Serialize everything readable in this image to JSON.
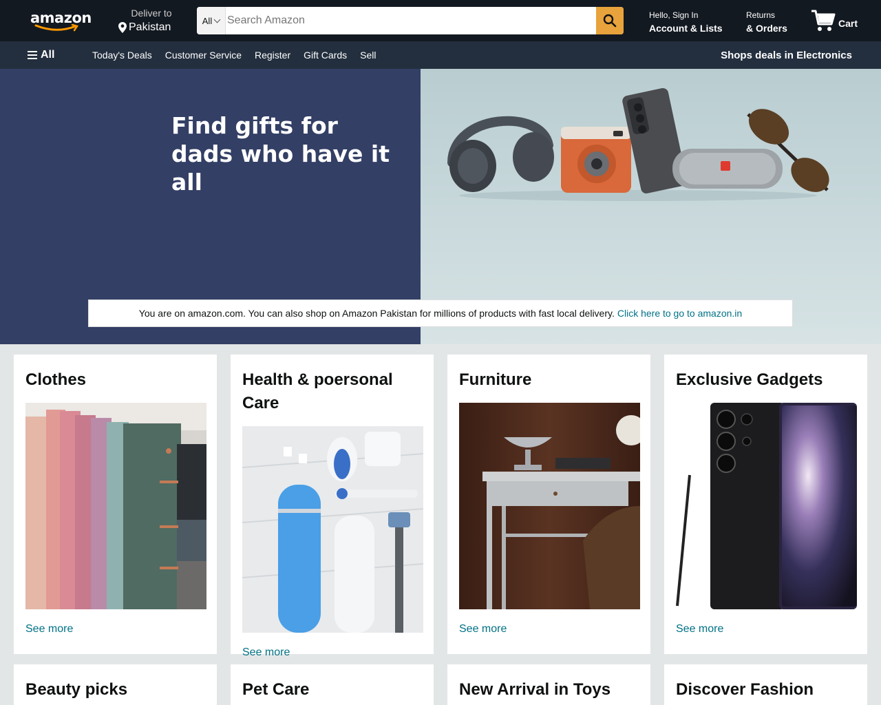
{
  "header": {
    "logo_text": "amazon",
    "deliver_label": "Deliver to",
    "deliver_location": "Pakistan",
    "search_category": "All",
    "search_placeholder": "Search Amazon",
    "account_line1": "Hello, Sign In",
    "account_line2": "Account & Lists",
    "orders_line1": "Returns",
    "orders_line2": "& Orders",
    "cart_label": "Cart"
  },
  "subnav": {
    "all_label": "All",
    "items": [
      "Today's Deals",
      "Customer Service",
      "Register",
      "Gift Cards",
      "Sell"
    ],
    "promo": "Shops deals in Electronics"
  },
  "hero": {
    "title_line1": "Find gifts for",
    "title_line2": "dads who have it all",
    "notice_text": "You are on amazon.com. You can also shop on Amazon Pakistan for millions of products with fast local delivery.",
    "notice_link": "Click here to go to amazon.in"
  },
  "cards": [
    {
      "title": "Clothes",
      "link": "See more"
    },
    {
      "title": "Health & poersonal Care",
      "link": "See more"
    },
    {
      "title": "Furniture",
      "link": "See more"
    },
    {
      "title": "Exclusive Gadgets",
      "link": "See more"
    },
    {
      "title": "Beauty picks"
    },
    {
      "title": "Pet Care"
    },
    {
      "title": "New Arrival in Toys"
    },
    {
      "title": "Discover Fashion"
    }
  ],
  "colors": {
    "header_bg": "#131921",
    "subnav_bg": "#232f3e",
    "hero_left": "#333f65",
    "search_button": "#e8a33c",
    "link": "#007185",
    "page_bg": "#e3e6e6"
  },
  "icons": [
    "pin-icon",
    "chevron-down-icon",
    "search-icon",
    "cart-icon",
    "hamburger-icon"
  ]
}
